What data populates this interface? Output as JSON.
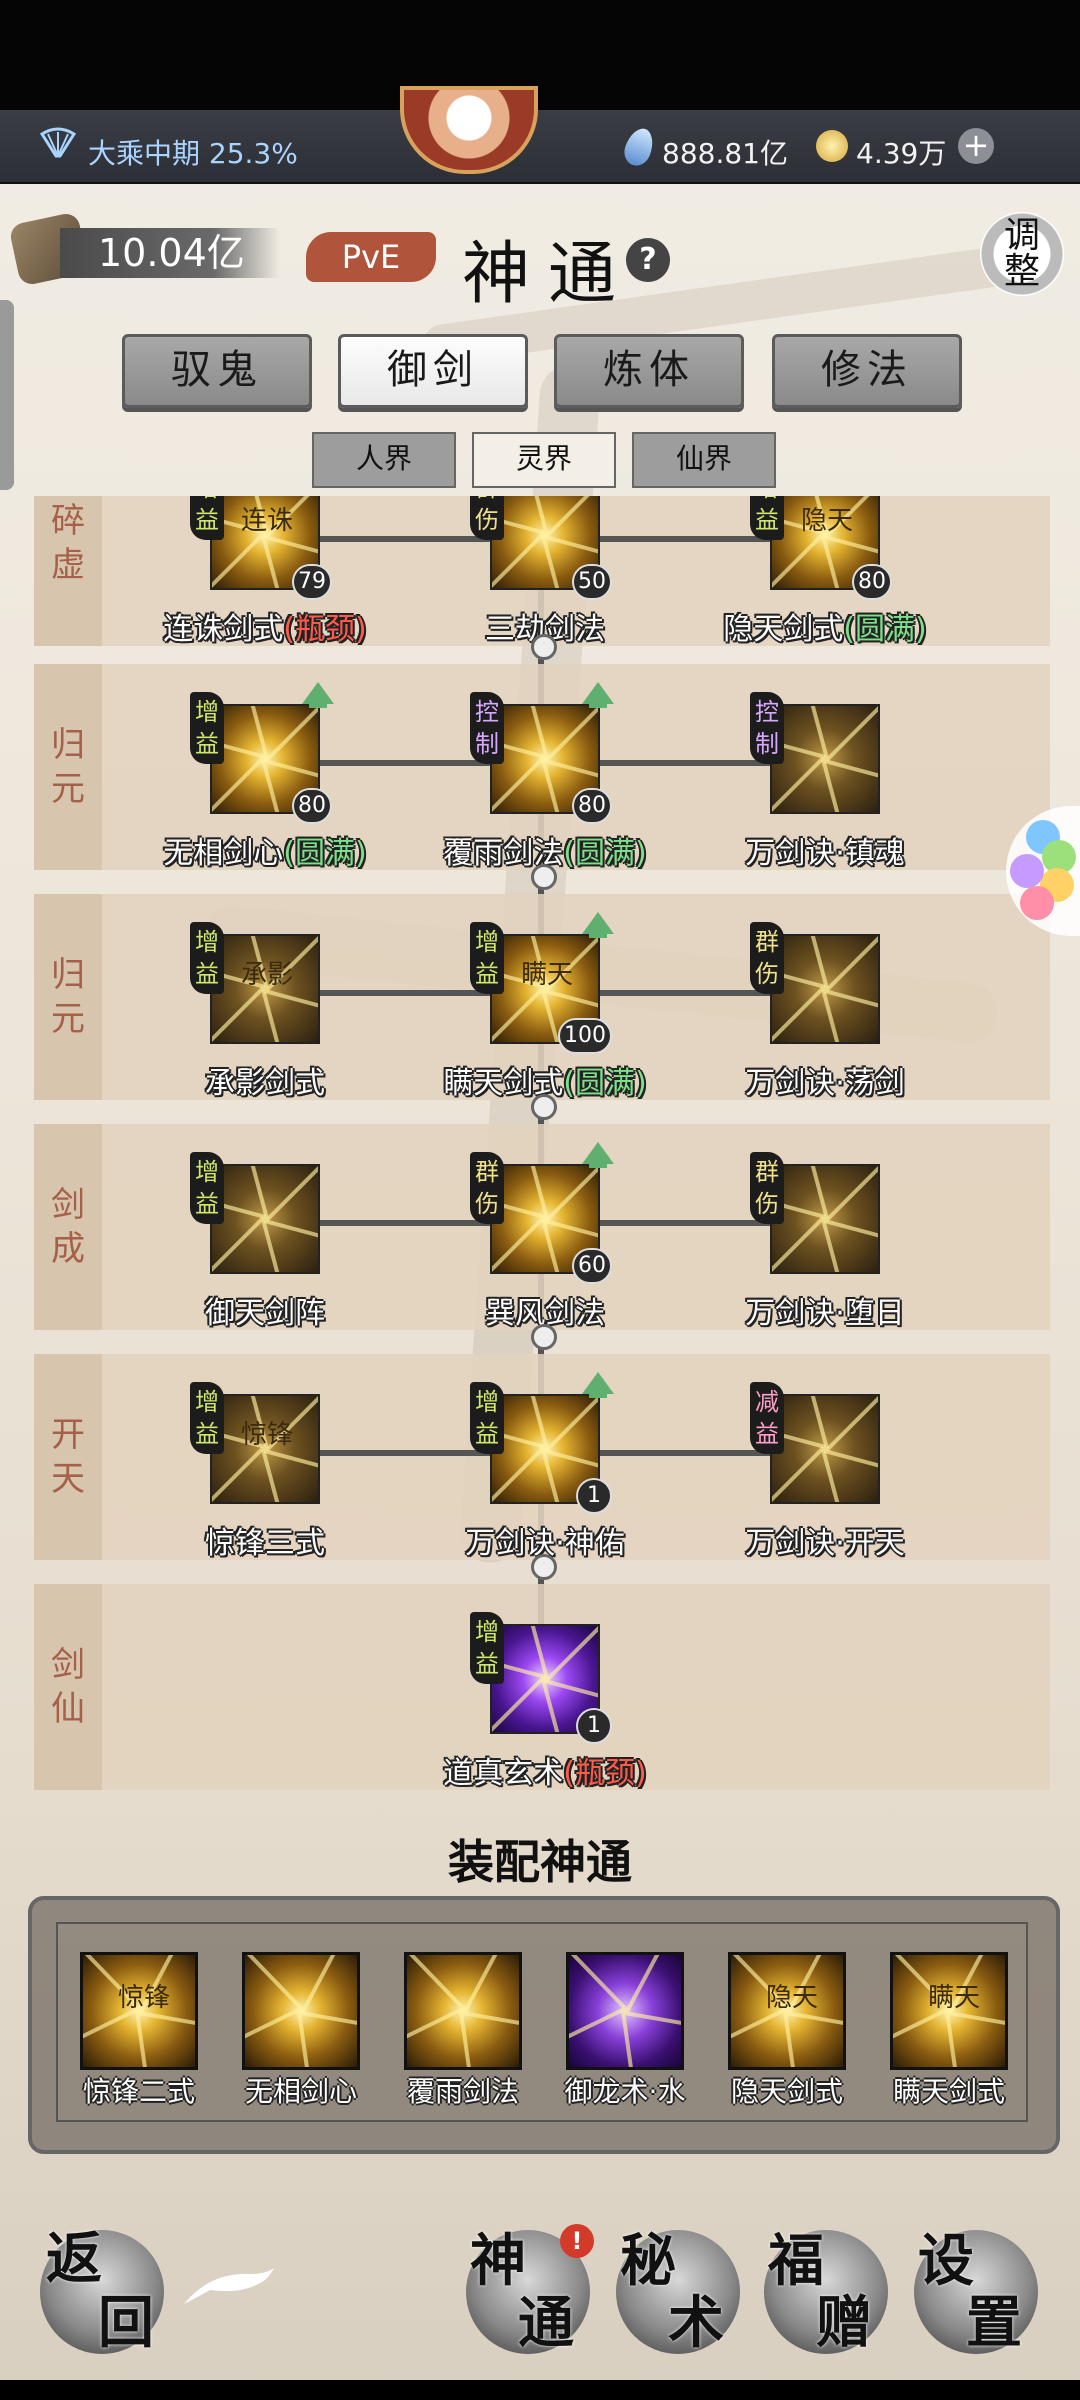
{
  "status": {
    "realm": "大乘中期 25.3%",
    "spirit_stones": "888.81亿",
    "currency": "4.39万",
    "add": "+"
  },
  "header": {
    "power": "10.04亿",
    "mode": "PvE",
    "title": "神通",
    "help": "?",
    "adjust": "调整"
  },
  "tabs": [
    "驭鬼",
    "御剑",
    "炼体",
    "修法"
  ],
  "selected_tab": "御剑",
  "subtabs": [
    "人界",
    "灵界",
    "仙界"
  ],
  "selected_subtab": "灵界",
  "rows": [
    {
      "label": "碎虚",
      "skills": [
        {
          "tag": "增益",
          "name": "连诛剑式",
          "suffix": "(瓶颈)",
          "level": "79",
          "glyph": "连诛"
        },
        {
          "tag": "群伤",
          "name": "三劫剑法",
          "suffix": "",
          "level": "50",
          "glyph": ""
        },
        {
          "tag": "增益",
          "name": "隐天剑式",
          "suffix": "(圆满)",
          "level": "80",
          "glyph": "隐天"
        }
      ]
    },
    {
      "label": "归元",
      "skills": [
        {
          "tag": "增益",
          "name": "无相剑心",
          "suffix": "(圆满)",
          "level": "80",
          "glyph": ""
        },
        {
          "tag": "控制",
          "name": "覆雨剑法",
          "suffix": "(圆满)",
          "level": "80",
          "glyph": ""
        },
        {
          "tag": "控制",
          "name": "万剑诀·镇魂",
          "suffix": "",
          "level": "",
          "glyph": ""
        }
      ]
    },
    {
      "label": "归元",
      "skills": [
        {
          "tag": "增益",
          "name": "承影剑式",
          "suffix": "",
          "level": "",
          "glyph": "承影"
        },
        {
          "tag": "增益",
          "name": "瞒天剑式",
          "suffix": "(圆满)",
          "level": "100",
          "glyph": "瞒天"
        },
        {
          "tag": "群伤",
          "name": "万剑诀·荡剑",
          "suffix": "",
          "level": "",
          "glyph": ""
        }
      ]
    },
    {
      "label": "剑成",
      "skills": [
        {
          "tag": "增益",
          "name": "御天剑阵",
          "suffix": "",
          "level": "",
          "glyph": ""
        },
        {
          "tag": "群伤",
          "name": "巽风剑法",
          "suffix": "",
          "level": "60",
          "glyph": ""
        },
        {
          "tag": "群伤",
          "name": "万剑诀·堕日",
          "suffix": "",
          "level": "",
          "glyph": ""
        }
      ]
    },
    {
      "label": "开天",
      "skills": [
        {
          "tag": "增益",
          "name": "惊锋三式",
          "suffix": "",
          "level": "",
          "glyph": "惊锋"
        },
        {
          "tag": "增益",
          "name": "万剑诀·神佑",
          "suffix": "",
          "level": "1",
          "glyph": ""
        },
        {
          "tag": "减益",
          "name": "万剑诀·开天",
          "suffix": "",
          "level": "",
          "glyph": ""
        }
      ]
    },
    {
      "label": "剑仙",
      "skills": [
        {
          "tag": "增益",
          "name": "道真玄术",
          "suffix": "(瓶颈)",
          "level": "1",
          "glyph": ""
        }
      ]
    }
  ],
  "equip": {
    "title": "装配神通",
    "slots": [
      {
        "name": "惊锋二式",
        "glyph": "惊锋"
      },
      {
        "name": "无相剑心",
        "glyph": ""
      },
      {
        "name": "覆雨剑法",
        "glyph": ""
      },
      {
        "name": "御龙术·水",
        "glyph": ""
      },
      {
        "name": "隐天剑式",
        "glyph": "隐天"
      },
      {
        "name": "瞒天剑式",
        "glyph": "瞒天"
      }
    ]
  },
  "bottom": {
    "back": "返回",
    "shentong": "神通",
    "mishu": "秘术",
    "fuzeng": "福赠",
    "shezhi": "设置",
    "alert": "!"
  },
  "colors": {
    "bottleneck": "#ff5a4a",
    "perfect": "#7ee08a",
    "upgrade_arrow": "#5fb070"
  }
}
